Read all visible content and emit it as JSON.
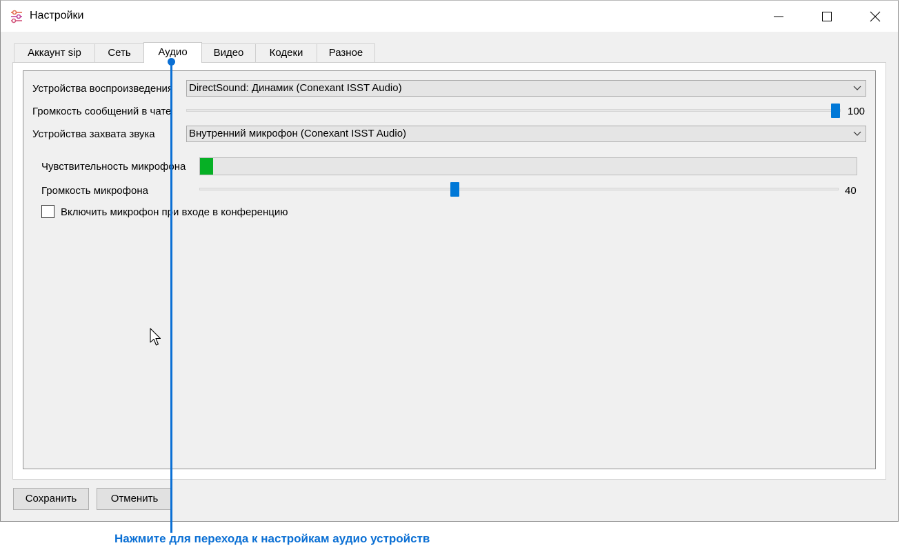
{
  "window": {
    "title": "Настройки",
    "icon": "settings-sliders-icon",
    "controls": [
      "minimize-icon",
      "maximize-icon",
      "close-icon"
    ]
  },
  "tabs": [
    {
      "label": "Аккаунт sip",
      "active": false
    },
    {
      "label": "Сеть",
      "active": false
    },
    {
      "label": "Аудио",
      "active": true
    },
    {
      "label": "Видео",
      "active": false
    },
    {
      "label": "Кодеки",
      "active": false
    },
    {
      "label": "Разное",
      "active": false
    }
  ],
  "audio": {
    "playback_label": "Устройства воспроизведения",
    "playback_value": "DirectSound: Динамик (Conexant ISST Audio)",
    "chat_volume_label": "Громкость сообщений в чате",
    "chat_volume_value": "100",
    "capture_label": "Устройства захвата звука",
    "capture_value": "Внутренний микрофон (Conexant ISST Audio)",
    "mic_sensitivity_label": "Чувствительность микрофона",
    "mic_sensitivity_level": 0.02,
    "mic_volume_label": "Громкость микрофона",
    "mic_volume_value": "40",
    "mic_on_join_label": "Включить микрофон при входе в конференцию",
    "mic_on_join_checked": false
  },
  "buttons": {
    "save_label": "Сохранить",
    "cancel_label": "Отменить"
  },
  "callout": {
    "text": "Нажмите для перехода к настройкам аудио устройств",
    "color": "#0a6fd4"
  },
  "colors": {
    "accent": "#0078d7",
    "level_fill": "#06b025"
  }
}
